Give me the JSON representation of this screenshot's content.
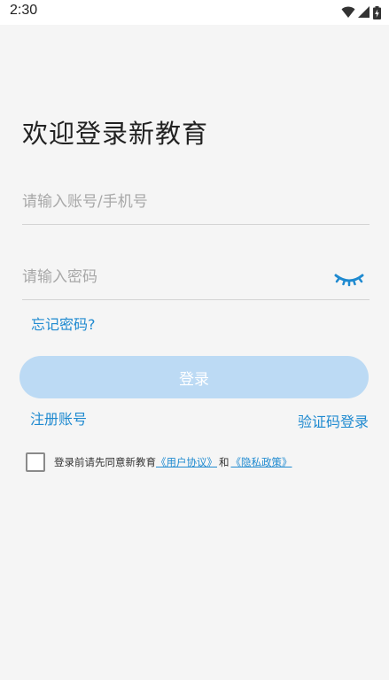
{
  "status_bar": {
    "time": "2:30",
    "icons": [
      "wifi-icon",
      "signal-icon",
      "battery-charging-icon"
    ]
  },
  "title": "欢迎登录新教育",
  "form": {
    "account_placeholder": "请输入账号/手机号",
    "account_value": "",
    "password_placeholder": "请输入密码",
    "password_value": "",
    "password_toggle_icon": "eye-closed-icon",
    "forgot_label": "忘记密码?",
    "login_label": "登录"
  },
  "links": {
    "register_label": "注册账号",
    "sms_login_label": "验证码登录"
  },
  "agreement": {
    "checked": false,
    "prefix": "登录前请先同意新教育",
    "user_agreement": "《用户协议》",
    "and": "和",
    "privacy_policy": "《隐私政策》"
  },
  "colors": {
    "accent": "#1f8ad0",
    "button_disabled": "#bcdaf4",
    "background": "#f5f5f5"
  }
}
